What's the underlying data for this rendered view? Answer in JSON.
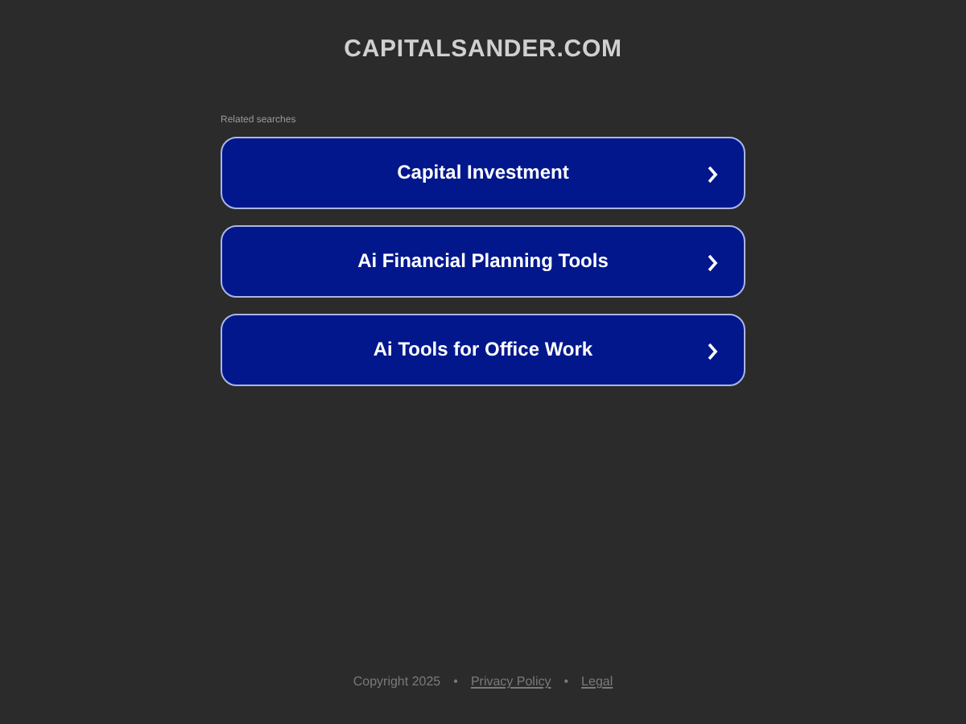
{
  "site_title": "CAPITALSANDER.COM",
  "related_label": "Related searches",
  "links": [
    {
      "label": "Capital Investment"
    },
    {
      "label": "Ai Financial Planning Tools"
    },
    {
      "label": "Ai Tools for Office Work"
    }
  ],
  "footer": {
    "copyright": "Copyright 2025",
    "separators": [
      "•",
      "•"
    ],
    "links": [
      "Privacy Policy",
      "Legal"
    ]
  }
}
